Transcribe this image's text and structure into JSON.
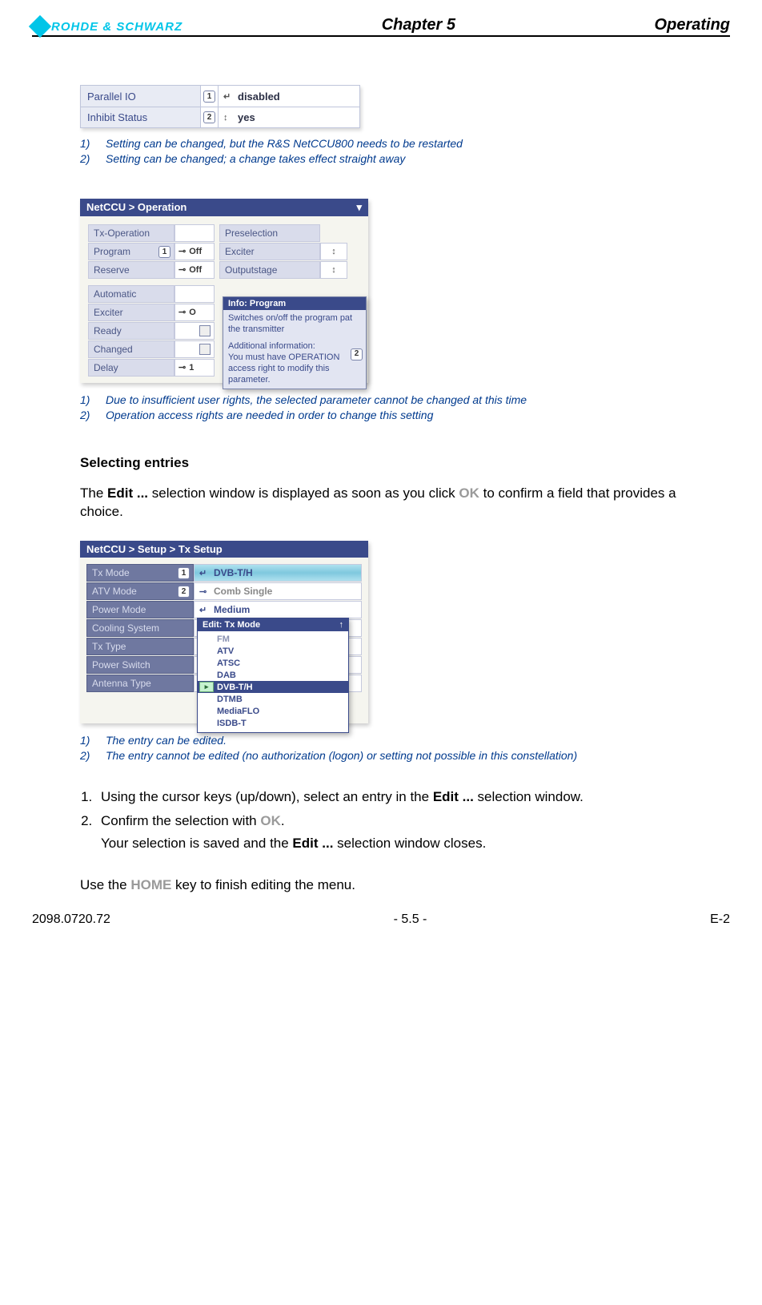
{
  "header": {
    "brand": "ROHDE & SCHWARZ",
    "center": "Chapter 5",
    "right": "Operating"
  },
  "shot1": {
    "rows": [
      {
        "label": "Parallel IO",
        "badge": "1",
        "icon": "↵",
        "value": "disabled"
      },
      {
        "label": "Inhibit Status",
        "badge": "2",
        "icon": "↕",
        "value": "yes"
      }
    ]
  },
  "notes1": {
    "n1_num": "1)",
    "n1_text": "Setting can be changed, but the R&S NetCCU800 needs to be restarted",
    "n2_num": "2)",
    "n2_text": "Setting can be changed; a change takes effect straight away"
  },
  "shot2": {
    "title": "NetCCU  >  Operation",
    "left_rows": [
      {
        "label": "Tx-Operation",
        "state": ""
      },
      {
        "label": "Program",
        "badge": "1",
        "state": "Off",
        "icon": "⊸"
      },
      {
        "label": "Reserve",
        "state": "Off",
        "icon": "⊸"
      }
    ],
    "right_rows": [
      {
        "label": "Preselection"
      },
      {
        "label": "Exciter",
        "sel": "↕"
      },
      {
        "label": "Outputstage",
        "sel": "↕"
      }
    ],
    "lower_rows": [
      {
        "label": "Automatic",
        "state": ""
      },
      {
        "label": "Exciter",
        "state": "O",
        "icon": "⊸"
      },
      {
        "label": "Ready",
        "state": "",
        "box": true
      },
      {
        "label": "Changed",
        "state": "",
        "box": true
      },
      {
        "label": "Delay",
        "state": "1",
        "icon": "⊸"
      }
    ],
    "tooltip": {
      "title": "Info: Program",
      "line1": "Switches on/off the program pat",
      "line2": "the transmitter",
      "line3": "Additional information:",
      "line4": "You must have OPERATION",
      "line5": "access right to modify this",
      "line6": "parameter.",
      "badge": "2"
    }
  },
  "notes2": {
    "n1_num": "1)",
    "n1_text": "Due to insufficient user rights, the selected parameter cannot be changed at this time",
    "n2_num": "2)",
    "n2_text": "Operation access rights are needed in order to change this setting"
  },
  "section": {
    "heading": "Selecting entries",
    "p1a": "The ",
    "p1b": "Edit ...",
    "p1c": " selection window is displayed as soon as you click ",
    "p1_ok": "OK",
    "p1d": " to confirm a field that provides a choice."
  },
  "shot3": {
    "title": "NetCCU  >  Setup > Tx Setup",
    "rows": [
      {
        "label": "Tx Mode",
        "badge": "1",
        "icon": "↵",
        "value": "DVB-T/H",
        "sel": true
      },
      {
        "label": "ATV Mode",
        "badge": "2",
        "icon": "⊸",
        "value": "Comb Single",
        "grey": true
      },
      {
        "label": "Power Mode",
        "icon": "↵",
        "value": "Medium"
      },
      {
        "label": "Cooling System",
        "value": ""
      },
      {
        "label": "Tx Type",
        "value": ""
      },
      {
        "label": "Power Switch",
        "value": ""
      },
      {
        "label": "Antenna Type",
        "value": ""
      }
    ],
    "dropdown": {
      "title": "Edit: Tx Mode",
      "arrow": "↑",
      "items": [
        {
          "text": "FM",
          "top": true
        },
        {
          "text": "ATV"
        },
        {
          "text": "ATSC"
        },
        {
          "text": "DAB"
        },
        {
          "text": "DVB-T/H",
          "sel": true
        },
        {
          "text": "DTMB"
        },
        {
          "text": "MediaFLO"
        },
        {
          "text": "ISDB-T"
        }
      ]
    }
  },
  "notes3": {
    "n1_num": "1)",
    "n1_text": "The entry can be edited.",
    "n2_num": "2)",
    "n2_text": "The entry cannot be edited (no authorization (logon) or setting not possible in this constellation)"
  },
  "steps": {
    "s1a": "Using the cursor keys (up/down), select an entry in the ",
    "s1b": "Edit ...",
    "s1c": " selection window.",
    "s2a": "Confirm the selection with ",
    "s2_ok": "OK",
    "s2b": ".",
    "s2_sub": "Your selection is saved and the ",
    "s2_sub_b": "Edit ...",
    "s2_sub_c": " selection window closes."
  },
  "closing": {
    "a": "Use the ",
    "home": "HOME",
    "b": " key to finish editing the menu."
  },
  "footer": {
    "left": "2098.0720.72",
    "center": "- 5.5 -",
    "right": "E-2"
  }
}
